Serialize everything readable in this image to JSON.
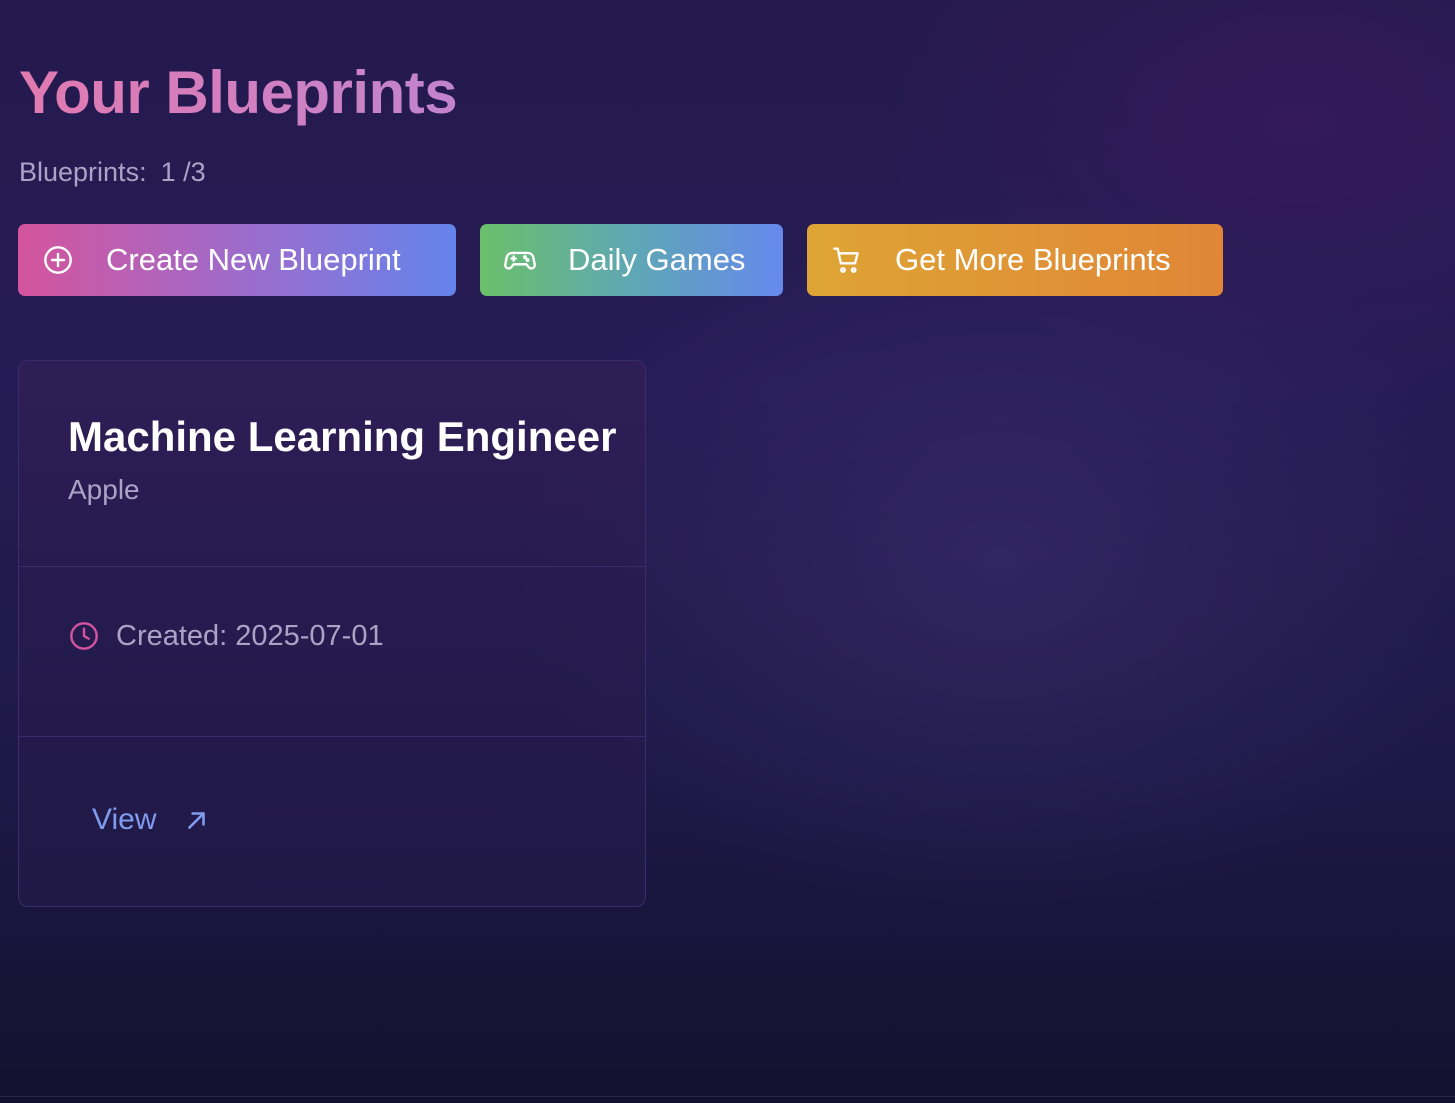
{
  "header": {
    "title": "Your Blueprints",
    "count_label": "Blueprints:",
    "count_value": "1 /3"
  },
  "actions": {
    "create_label": "Create New Blueprint",
    "games_label": "Daily Games",
    "more_label": "Get More Blueprints",
    "create_icon": "plus-circle-icon",
    "games_icon": "gamepad-icon",
    "more_icon": "shopping-cart-icon"
  },
  "blueprints": [
    {
      "title": "Machine Learning Engineer",
      "company": "Apple",
      "created_label": "Created:",
      "created_date": "2025-07-01",
      "view_label": "View"
    }
  ],
  "colors": {
    "title_gradient": [
      "#e27ab0",
      "#c283cf"
    ],
    "create_gradient": [
      "#d4549d",
      "#6484ec"
    ],
    "games_gradient": [
      "#6bbf6a",
      "#6589ec"
    ],
    "more_gradient": [
      "#dea435",
      "#e08636"
    ],
    "link": "#7f9cf0",
    "clock_icon": "#d4549d"
  }
}
